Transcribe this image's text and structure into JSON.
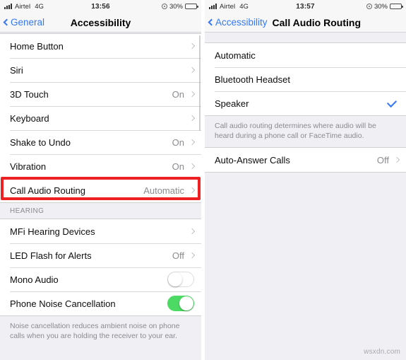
{
  "left_phone": {
    "status_bar": {
      "carrier": "Airtel",
      "network": "4G",
      "time": "13:56",
      "battery_percent": "30%",
      "signal_icon": "signal-bars-icon",
      "location_icon": "location-services-icon",
      "battery_icon": "battery-icon"
    },
    "nav": {
      "back_label": "General",
      "title": "Accessibility",
      "back_icon": "chevron-left-icon"
    },
    "group1": [
      {
        "label": "Home Button",
        "value": "",
        "accessory": "chevron"
      },
      {
        "label": "Siri",
        "value": "",
        "accessory": "chevron"
      },
      {
        "label": "3D Touch",
        "value": "On",
        "accessory": "chevron"
      },
      {
        "label": "Keyboard",
        "value": "",
        "accessory": "chevron"
      },
      {
        "label": "Shake to Undo",
        "value": "On",
        "accessory": "chevron"
      },
      {
        "label": "Vibration",
        "value": "On",
        "accessory": "chevron"
      },
      {
        "label": "Call Audio Routing",
        "value": "Automatic",
        "accessory": "chevron"
      }
    ],
    "hearing_header": "HEARING",
    "group2": [
      {
        "label": "MFi Hearing Devices",
        "value": "",
        "accessory": "chevron"
      },
      {
        "label": "LED Flash for Alerts",
        "value": "Off",
        "accessory": "chevron"
      },
      {
        "label": "Mono Audio",
        "value": "",
        "accessory": "toggle-off"
      },
      {
        "label": "Phone Noise Cancellation",
        "value": "",
        "accessory": "toggle-on"
      }
    ],
    "footer_note": "Noise cancellation reduces ambient noise on phone calls when you are holding the receiver to your ear.",
    "highlight_color": "#ED2024"
  },
  "right_phone": {
    "status_bar": {
      "carrier": "Airtel",
      "network": "4G",
      "time": "13:57",
      "battery_percent": "30%",
      "signal_icon": "signal-bars-icon",
      "location_icon": "location-services-icon",
      "battery_icon": "battery-icon"
    },
    "nav": {
      "back_label": "Accessibility",
      "title": "Call Audio Routing",
      "back_icon": "chevron-left-icon"
    },
    "group1": [
      {
        "label": "Automatic",
        "value": "",
        "accessory": "none"
      },
      {
        "label": "Bluetooth Headset",
        "value": "",
        "accessory": "none"
      },
      {
        "label": "Speaker",
        "value": "",
        "accessory": "checkmark"
      }
    ],
    "footer_note": "Call audio routing determines where audio will be heard during a phone call or FaceTime audio.",
    "group2": [
      {
        "label": "Auto-Answer Calls",
        "value": "Off",
        "accessory": "chevron"
      }
    ],
    "selected_option": "Speaker",
    "accent_color": "#3478F6"
  },
  "watermark": "wsxdn.com"
}
